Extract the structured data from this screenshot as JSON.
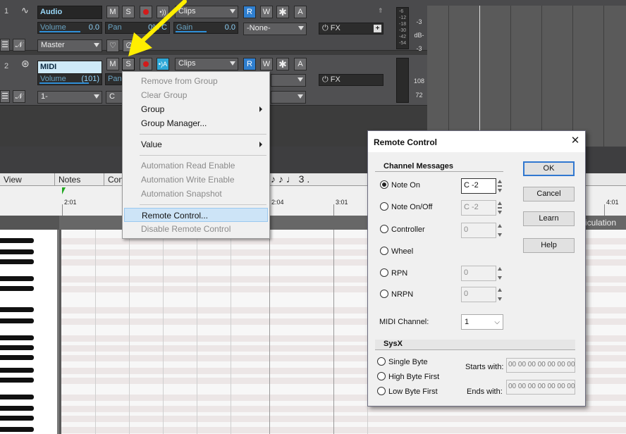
{
  "tracks": [
    {
      "number": "1",
      "name": "Audio",
      "mute": "M",
      "solo": "S",
      "write": "W",
      "auto": "A",
      "clips": "Clips",
      "volume_label": "Volume",
      "volume_value": "0.0",
      "pan_label": "Pan",
      "pan_value": "0% C",
      "gain_label": "Gain",
      "gain_value": "0.0",
      "input": "-None-",
      "output": "Master",
      "fx": "FX",
      "read": "R",
      "meter_scale": [
        "-6",
        "-12",
        "-18",
        "-30",
        "-42",
        "-54"
      ],
      "db_label": "dB-",
      "db_top": "-3",
      "db_bottom": "-3"
    },
    {
      "number": "2",
      "name": "MIDI",
      "mute": "M",
      "solo": "S",
      "write": "W",
      "auto": "A",
      "clips": "Clips",
      "volume_label": "Volume",
      "volume_value": "(101)",
      "pan_label": "Pan",
      "output": "1-",
      "output2": "C",
      "fx": "FX",
      "read": "R",
      "vel_top": "108",
      "vel_bottom": "72"
    }
  ],
  "proll_tabs": [
    "View",
    "Notes",
    "Con"
  ],
  "ruler": [
    "2:01",
    "2:04",
    "3:01",
    "4:01"
  ],
  "articulation_label": "iculation",
  "note_durations": [
    "3",
    "."
  ],
  "context_menu": {
    "items": [
      {
        "label": "Remove from Group",
        "disabled": true
      },
      {
        "label": "Clear Group",
        "disabled": true
      },
      {
        "label": "Group",
        "disabled": false,
        "submenu": true
      },
      {
        "label": "Group Manager...",
        "disabled": false
      },
      {
        "label": "Value",
        "disabled": false,
        "submenu": true
      },
      {
        "label": "Automation Read Enable",
        "disabled": true
      },
      {
        "label": "Automation Write Enable",
        "disabled": true
      },
      {
        "label": "Automation Snapshot",
        "disabled": true
      },
      {
        "label": "Remote Control...",
        "disabled": false,
        "highlighted": true
      },
      {
        "label": "Disable Remote Control",
        "disabled": true
      }
    ]
  },
  "dialog": {
    "title": "Remote Control",
    "close": "✕",
    "channel_messages": "Channel Messages",
    "options": [
      {
        "label": "Note On",
        "value": "C -2",
        "checked": true,
        "active": true
      },
      {
        "label": "Note On/Off",
        "value": "C -2",
        "checked": false
      },
      {
        "label": "Controller",
        "value": "0",
        "checked": false
      },
      {
        "label": "Wheel",
        "value": "",
        "checked": false
      },
      {
        "label": "RPN",
        "value": "0",
        "checked": false
      },
      {
        "label": "NRPN",
        "value": "0",
        "checked": false
      }
    ],
    "midi_channel_label": "MIDI Channel:",
    "midi_channel_value": "1",
    "sysx": "SysX",
    "sysx_options": [
      "Single Byte",
      "High Byte First",
      "Low Byte First"
    ],
    "starts_with_label": "Starts with:",
    "starts_with_value": "00 00 00 00 00 00 00",
    "ends_with_label": "Ends with:",
    "ends_with_value": "00 00 00 00 00 00 00",
    "buttons": {
      "ok": "OK",
      "cancel": "Cancel",
      "learn": "Learn",
      "help": "Help"
    }
  },
  "colors": {
    "arrow": "#ffee00",
    "menu_highlight": "#cde4f7",
    "track_name": "#9ad8f8"
  }
}
